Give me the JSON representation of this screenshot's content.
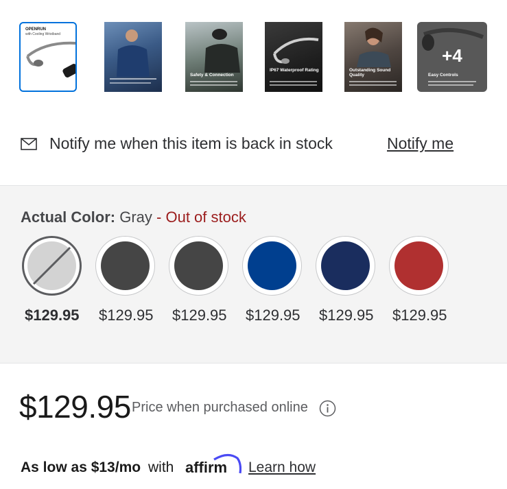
{
  "thumbnails": [
    {
      "caption": "OPENRUN",
      "subcaption": "with Cooling Wristband"
    },
    {
      "caption": ""
    },
    {
      "caption": "Safety & Connection"
    },
    {
      "caption": "IP67 Waterproof Rating"
    },
    {
      "caption": "Outstanding Sound Quality"
    },
    {
      "caption": "Easy Controls",
      "overlay": "+4"
    }
  ],
  "notify": {
    "text": "Notify me when this item is back in stock",
    "link": "Notify me",
    "icon": "mail-icon"
  },
  "color": {
    "label": "Actual Color:",
    "value": " Gray",
    "status": " - Out of stock",
    "swatches": [
      {
        "name": "Gray",
        "color": "#d3d3d3",
        "price": "$129.95",
        "selected": true,
        "unavailable": true
      },
      {
        "name": "Black",
        "color": "#454545",
        "price": "$129.95"
      },
      {
        "name": "Black",
        "color": "#454545",
        "price": "$129.95"
      },
      {
        "name": "Blue",
        "color": "#003f8f",
        "price": "$129.95"
      },
      {
        "name": "Navy",
        "color": "#1a2d5e",
        "price": "$129.95"
      },
      {
        "name": "Red",
        "color": "#b03030",
        "price": "$129.95"
      }
    ]
  },
  "price": {
    "amount": "$129.95",
    "note": "Price when purchased online",
    "info_icon": "info-icon"
  },
  "affirm": {
    "as_low": "As low as $13/mo",
    "with": "with",
    "brand": "affirm",
    "learn": "Learn how"
  }
}
